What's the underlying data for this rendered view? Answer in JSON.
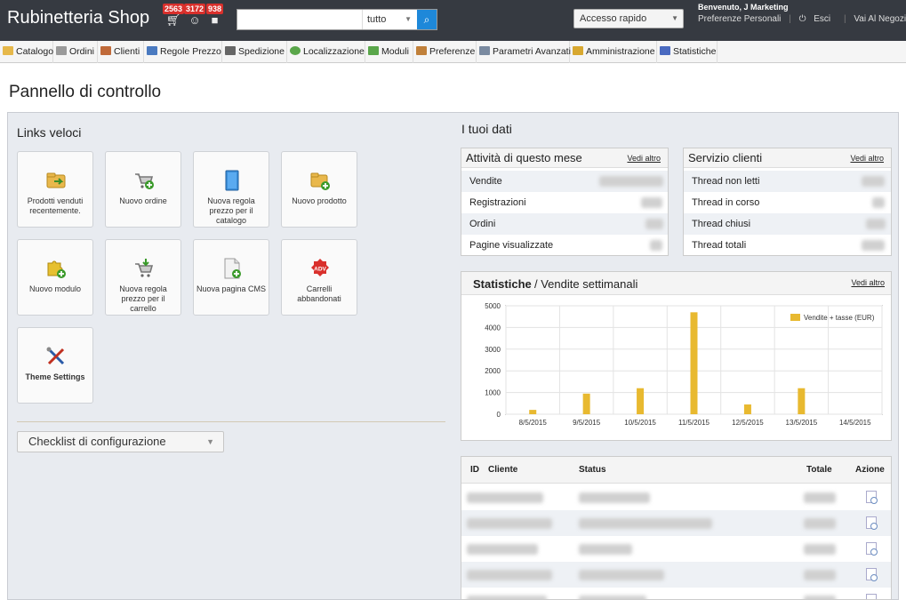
{
  "header": {
    "shop_name": "Rubinetteria Shop",
    "notifications": [
      {
        "count": "2563",
        "icon": "cart-icon"
      },
      {
        "count": "3172",
        "icon": "user-icon"
      },
      {
        "count": "938",
        "icon": "chat-icon"
      }
    ],
    "search": {
      "value": "",
      "scope": "tutto"
    },
    "quick_access": "Accesso rapido",
    "welcome_prefix": "Benvenuto,",
    "welcome_name": "J Marketing",
    "links": {
      "preferences": "Preferenze Personali",
      "logout": "Esci",
      "store": "Vai Al Negozio"
    }
  },
  "menu": [
    {
      "label": "Catalogo",
      "icon": "folder-icon",
      "color": "#e6b84a"
    },
    {
      "label": "Ordini",
      "icon": "cart-icon",
      "color": "#8a8a8a"
    },
    {
      "label": "Clienti",
      "icon": "user-icon",
      "color": "#c06a3a"
    },
    {
      "label": "Regole Prezzo",
      "icon": "price-rule-icon",
      "color": "#4a7ac0"
    },
    {
      "label": "Spedizione",
      "icon": "truck-icon",
      "color": "#666666"
    },
    {
      "label": "Localizzazione",
      "icon": "globe-icon",
      "color": "#5aa64a"
    },
    {
      "label": "Moduli",
      "icon": "puzzle-icon",
      "color": "#5aa64a"
    },
    {
      "label": "Preferenze",
      "icon": "preferences-icon",
      "color": "#c0803a"
    },
    {
      "label": "Parametri Avanzati",
      "icon": "wrench-icon",
      "color": "#7a8aa0"
    },
    {
      "label": "Amministrazione",
      "icon": "key-icon",
      "color": "#d8a830"
    },
    {
      "label": "Statistiche",
      "icon": "bar-chart-icon",
      "color": "#4a6ac0"
    }
  ],
  "page_title": "Pannello di controllo",
  "quick_links": {
    "title": "Links veloci",
    "tiles": [
      {
        "label": "Prodotti venduti recentemente.",
        "icon": "recent-products-icon"
      },
      {
        "label": "Nuovo ordine",
        "icon": "new-order-icon"
      },
      {
        "label": "Nuova regola prezzo per il catalogo",
        "icon": "catalog-rule-icon"
      },
      {
        "label": "Nuovo prodotto",
        "icon": "new-product-icon"
      },
      {
        "label": "Nuovo modulo",
        "icon": "new-module-icon"
      },
      {
        "label": "Nuova regola prezzo per il carrello",
        "icon": "cart-rule-icon"
      },
      {
        "label": "Nuova pagina CMS",
        "icon": "new-cms-page-icon"
      },
      {
        "label": "Carrelli abbandonati",
        "icon": "abandoned-carts-icon",
        "badge": "ADV"
      },
      {
        "label": "Theme Settings",
        "icon": "theme-settings-icon"
      }
    ]
  },
  "checklist": "Checklist di configurazione",
  "your_data": {
    "title": "I tuoi dati",
    "activity": {
      "title": "Attività di questo mese",
      "more": "Vedi altro",
      "rows": [
        "Vendite",
        "Registrazioni",
        "Ordini",
        "Pagine visualizzate"
      ]
    },
    "customer_service": {
      "title": "Servizio clienti",
      "more": "Vedi altro",
      "rows": [
        "Thread non letti",
        "Thread in corso",
        "Thread chiusi",
        "Thread totali"
      ]
    }
  },
  "stats": {
    "title_strong": "Statistiche",
    "title_rest": "/ Vendite settimanali",
    "more": "Vedi altro"
  },
  "chart_data": {
    "type": "bar",
    "categories": [
      "8/5/2015",
      "9/5/2015",
      "10/5/2015",
      "11/5/2015",
      "12/5/2015",
      "13/5/2015",
      "14/5/2015"
    ],
    "x_ticks_count": 8,
    "series": [
      {
        "name": "Vendite + tasse (EUR)",
        "color": "#e8b930",
        "values": [
          200,
          950,
          1200,
          4700,
          450,
          1200,
          0
        ]
      }
    ],
    "yticks": [
      0,
      1000,
      2000,
      3000,
      4000,
      5000
    ],
    "ylim": [
      0,
      5000
    ],
    "grid": true,
    "legend_position": "top-right"
  },
  "orders": {
    "columns": {
      "id": "ID",
      "customer": "Cliente",
      "status": "Status",
      "total": "Totale",
      "action": "Azione"
    },
    "rows": 5
  }
}
